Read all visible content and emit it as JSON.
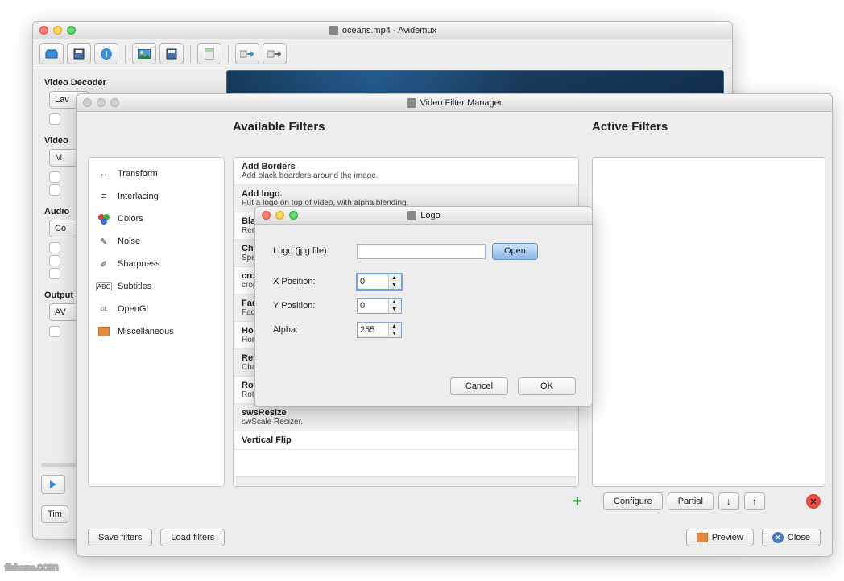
{
  "main": {
    "title": "oceans.mp4 - Avidemux",
    "sections": {
      "decoder": "Video Decoder",
      "decoder_btn": "Lav",
      "video": "Video",
      "video_btn": "M",
      "audio": "Audio",
      "audio_btn": "Co",
      "output": "Output",
      "output_btn": "AV"
    },
    "time_btn": "Tim"
  },
  "fm": {
    "title": "Video Filter Manager",
    "h_avail": "Available Filters",
    "h_active": "Active Filters",
    "cats": [
      "Transform",
      "Interlacing",
      "Colors",
      "Noise",
      "Sharpness",
      "Subtitles",
      "OpenGl",
      "Miscellaneous"
    ],
    "filters": [
      {
        "n": "Add Borders",
        "d": "Add black boarders around the image."
      },
      {
        "n": "Add logo.",
        "d": "Put a logo on top of video, with alpha blending."
      },
      {
        "n": "Blacken Bo",
        "d": "Remove noisy"
      },
      {
        "n": "Change FP",
        "d": "Speed up/slow"
      },
      {
        "n": "crop",
        "d": "crop filter"
      },
      {
        "n": "Fade",
        "d": "Fade in/out."
      },
      {
        "n": "Horizontal",
        "d": "Horizontally fl"
      },
      {
        "n": "Resample",
        "d": "Change and e"
      },
      {
        "n": "Rotate",
        "d": "Rotate the ima"
      },
      {
        "n": "swsResize",
        "d": "swScale Resizer."
      },
      {
        "n": "Vertical Flip",
        "d": ""
      }
    ],
    "btn_configure": "Configure",
    "btn_partial": "Partial",
    "btn_save": "Save filters",
    "btn_load": "Load filters",
    "btn_preview": "Preview",
    "btn_close": "Close"
  },
  "logo": {
    "title": "Logo",
    "lbl_file": "Logo (jpg file):",
    "val_file": "",
    "btn_open": "Open",
    "lbl_x": "X Position:",
    "val_x": "0",
    "lbl_y": "Y Position:",
    "val_y": "0",
    "lbl_a": "Alpha:",
    "val_a": "255",
    "btn_cancel": "Cancel",
    "btn_ok": "OK"
  },
  "watermark": "filehorse",
  "watermark_suffix": ".com"
}
